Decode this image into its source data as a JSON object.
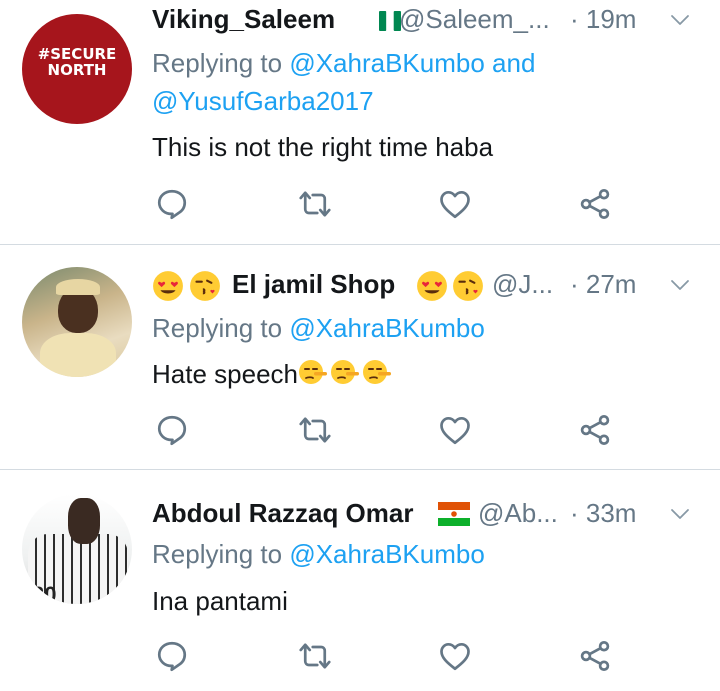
{
  "tweets": [
    {
      "name": "Viking_Saleem",
      "flag": "nigeria-flag",
      "handle": "@Saleem_...",
      "time": "· 19m",
      "reply_prefix": "Replying to ",
      "reply_to_1": "@XahraBKumbo",
      "reply_join": " and",
      "reply_to_2": "@YusufGarba2017",
      "text": "This is not the right time haba",
      "avatar_text_1": "#SECURE",
      "avatar_text_2": "NORTH"
    },
    {
      "name": "El jamil Shop",
      "handle": "@J...",
      "time": "· 27m",
      "reply_prefix": "Replying to ",
      "reply_to_1": "@XahraBKumbo",
      "text": "Hate speech"
    },
    {
      "name": "Abdoul Razzaq Omar",
      "flag": "niger-flag",
      "handle": "@Ab...",
      "time": "· 33m",
      "reply_prefix": "Replying to ",
      "reply_to_1": "@XahraBKumbo",
      "text": "Ina pantami"
    }
  ],
  "colors": {
    "name": "#14171a",
    "secondary": "#657786",
    "mention": "#1da1f2",
    "icon": "#657786",
    "divider": "#d4dbe1",
    "avatar_red": "#a6151c"
  },
  "icons": [
    "reply-icon",
    "retweet-icon",
    "like-icon",
    "share-icon",
    "chevron-down-icon"
  ]
}
